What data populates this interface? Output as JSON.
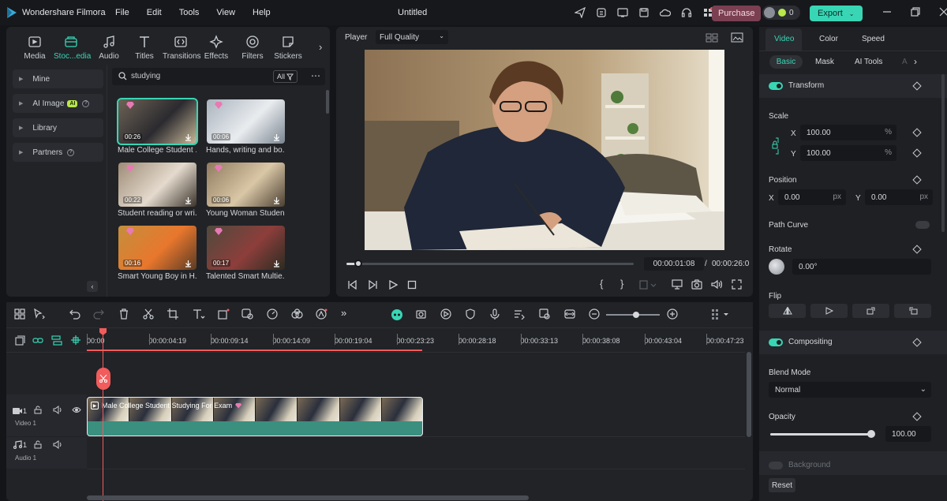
{
  "app": {
    "name": "Wondershare Filmora",
    "document_title": "Untitled"
  },
  "menu": [
    "File",
    "Edit",
    "Tools",
    "View",
    "Help"
  ],
  "titlebar": {
    "purchase_label": "Purchase",
    "credits": "0",
    "export_label": "Export"
  },
  "media_tabs": [
    "Media",
    "Stoc...edia",
    "Audio",
    "Titles",
    "Transitions",
    "Effects",
    "Filters",
    "Stickers"
  ],
  "sidebar": [
    {
      "label": "Mine"
    },
    {
      "label": "AI Image",
      "badge": "AI"
    },
    {
      "label": "Library"
    },
    {
      "label": "Partners"
    }
  ],
  "search": {
    "value": "studying",
    "filter_label": "All"
  },
  "stock_items": [
    {
      "duration": "00:26",
      "caption": "Male College Student ..."
    },
    {
      "duration": "00:06",
      "caption": "Hands, writing and bo..."
    },
    {
      "duration": "00:22",
      "caption": "Student reading or wri..."
    },
    {
      "duration": "00:06",
      "caption": "Young Woman Studen..."
    },
    {
      "duration": "00:16",
      "caption": "Smart Young Boy in H..."
    },
    {
      "duration": "00:17",
      "caption": "Talented Smart Multie..."
    }
  ],
  "player": {
    "label": "Player",
    "quality": "Full Quality",
    "current_time": "00:00:01:08",
    "separator": "/",
    "total_time": "00:00:26:0",
    "progress": 0.04,
    "brace_left": "{",
    "brace_right": "}"
  },
  "properties": {
    "tabs": [
      "Video",
      "Color",
      "Speed"
    ],
    "subtabs": [
      "Basic",
      "Mask",
      "AI Tools",
      "A"
    ],
    "transform_label": "Transform",
    "scale_label": "Scale",
    "scale_x_label": "X",
    "scale_x": "100.00",
    "scale_y_label": "Y",
    "scale_y": "100.00",
    "percent": "%",
    "position_label": "Position",
    "pos_x_label": "X",
    "pos_x": "0.00",
    "pos_y_label": "Y",
    "pos_y": "0.00",
    "px": "px",
    "path_curve_label": "Path Curve",
    "rotate_label": "Rotate",
    "rotate_value": "0.00°",
    "flip_label": "Flip",
    "compositing_label": "Compositing",
    "blend_mode_label": "Blend Mode",
    "blend_mode_value": "Normal",
    "opacity_label": "Opacity",
    "opacity_value": "100.00",
    "opacity_level": 1.0,
    "background_label": "Background",
    "reset_label": "Reset"
  },
  "timeline": {
    "ruler": [
      "00:00",
      "00:00:04:19",
      "00:00:09:14",
      "00:00:14:09",
      "00:00:19:04",
      "00:00:23:23",
      "00:00:28:18",
      "00:00:33:13",
      "00:00:38:08",
      "00:00:43:04",
      "00:00:47:23"
    ],
    "tracks": [
      {
        "num": "1",
        "label": "Video 1"
      },
      {
        "num": "1",
        "label": "Audio 1"
      }
    ],
    "clip_title": "Male College Student Studying For Exam"
  },
  "colors": {
    "accent": "#38d6b5",
    "playhead": "#f25c5c",
    "clip": "#3a8f7f",
    "purchase": "#7b3f52"
  }
}
